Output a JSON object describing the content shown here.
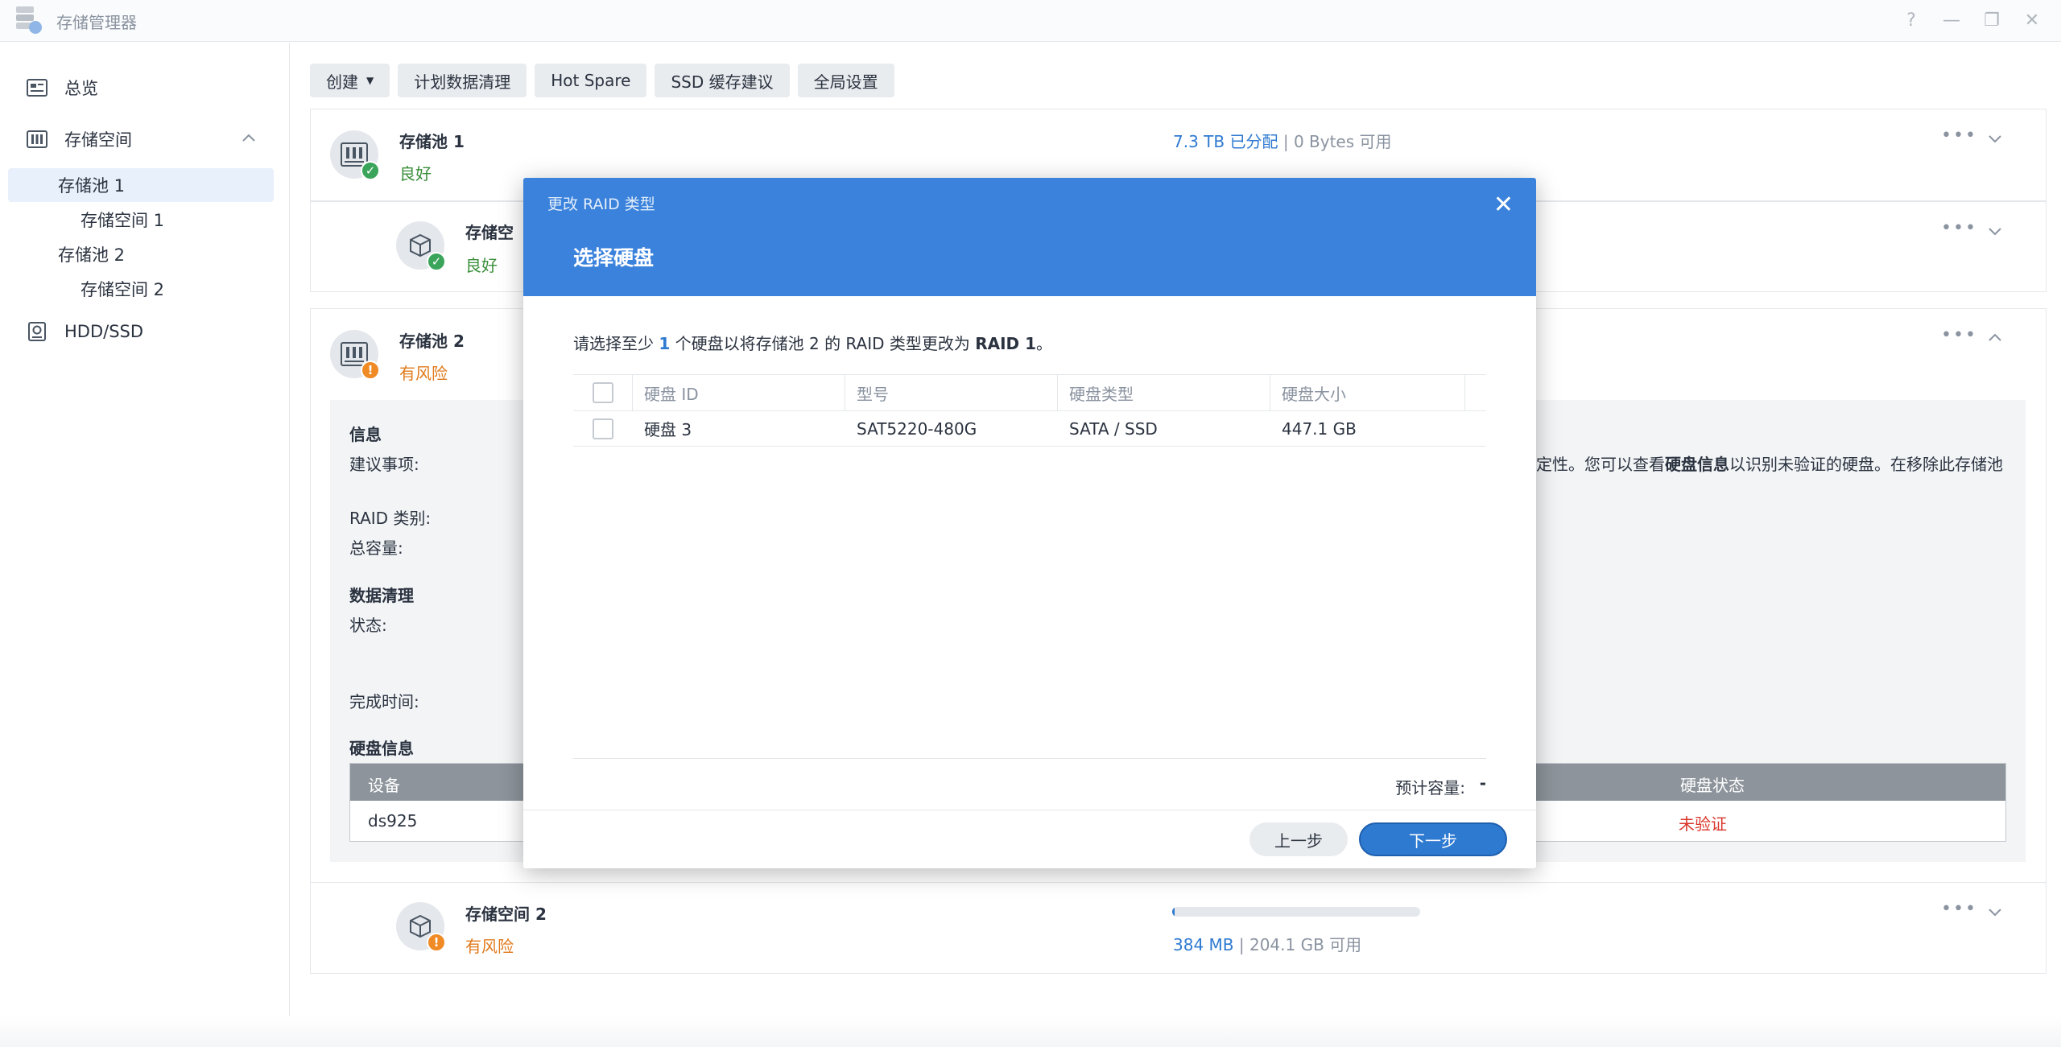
{
  "app": {
    "title": "存储管理器"
  },
  "window_controls": [
    "?",
    "—",
    "❐",
    "✕"
  ],
  "sidebar": {
    "items": [
      {
        "label": "总览"
      },
      {
        "label": "存储空间"
      },
      {
        "label": "存储池 1"
      },
      {
        "label": "存储空间 1"
      },
      {
        "label": "存储池 2"
      },
      {
        "label": "存储空间 2"
      },
      {
        "label": "HDD/SSD"
      }
    ]
  },
  "toolbar": {
    "create": "创建",
    "scrub": "计划数据清理",
    "hotspare": "Hot Spare",
    "ssd": "SSD 缓存建议",
    "global": "全局设置"
  },
  "pool1": {
    "name": "存储池 1",
    "status": "良好",
    "allocated": "7.3 TB 已分配",
    "sep": "|",
    "available": "0 Bytes 可用"
  },
  "volume1": {
    "name": "存储空",
    "status": "良好"
  },
  "pool2": {
    "name": "存储池 2",
    "status": "有风险",
    "info_title": "信息",
    "suggestion_label": "建议事项:",
    "suggestion_text_a": "定性。您可以查看",
    "suggestion_text_bold": "硬盘信息",
    "suggestion_text_b": "以识别未验证的硬盘。在移除此存储池",
    "raid_label": "RAID 类别:",
    "capacity_label": "总容量:",
    "scrub_title": "数据清理",
    "state_label": "状态:",
    "done_label": "完成时间:",
    "disk_title": "硬盘信息",
    "table": {
      "col_device": "设备",
      "col_state": "硬盘状态",
      "row_device": "ds925",
      "row_state": "未验证"
    }
  },
  "volume2": {
    "name": "存储空间 2",
    "status": "有风险",
    "used": "384 MB",
    "sep": "|",
    "available": "204.1 GB 可用",
    "progress": 0.01
  },
  "modal": {
    "title_small": "更改 RAID 类型",
    "title_big": "选择硬盘",
    "desc_a": "请选择至少",
    "desc_num": "1",
    "desc_b": "个硬盘以将存储池 2 的 RAID 类型更改为",
    "desc_raid": "RAID 1",
    "desc_end": "。",
    "columns": [
      "硬盘 ID",
      "型号",
      "硬盘类型",
      "硬盘大小"
    ],
    "rows": [
      {
        "id": "硬盘 3",
        "model": "SAT5220-480G",
        "type": "SATA / SSD",
        "size": "447.1 GB"
      }
    ],
    "est_label": "预计容量:",
    "est_value": "-",
    "prev": "上一步",
    "next": "下一步"
  },
  "colors": {
    "accent": "#3a82dc",
    "ok": "#3aa55a",
    "warn": "#f08a24",
    "danger": "#d9362b"
  }
}
